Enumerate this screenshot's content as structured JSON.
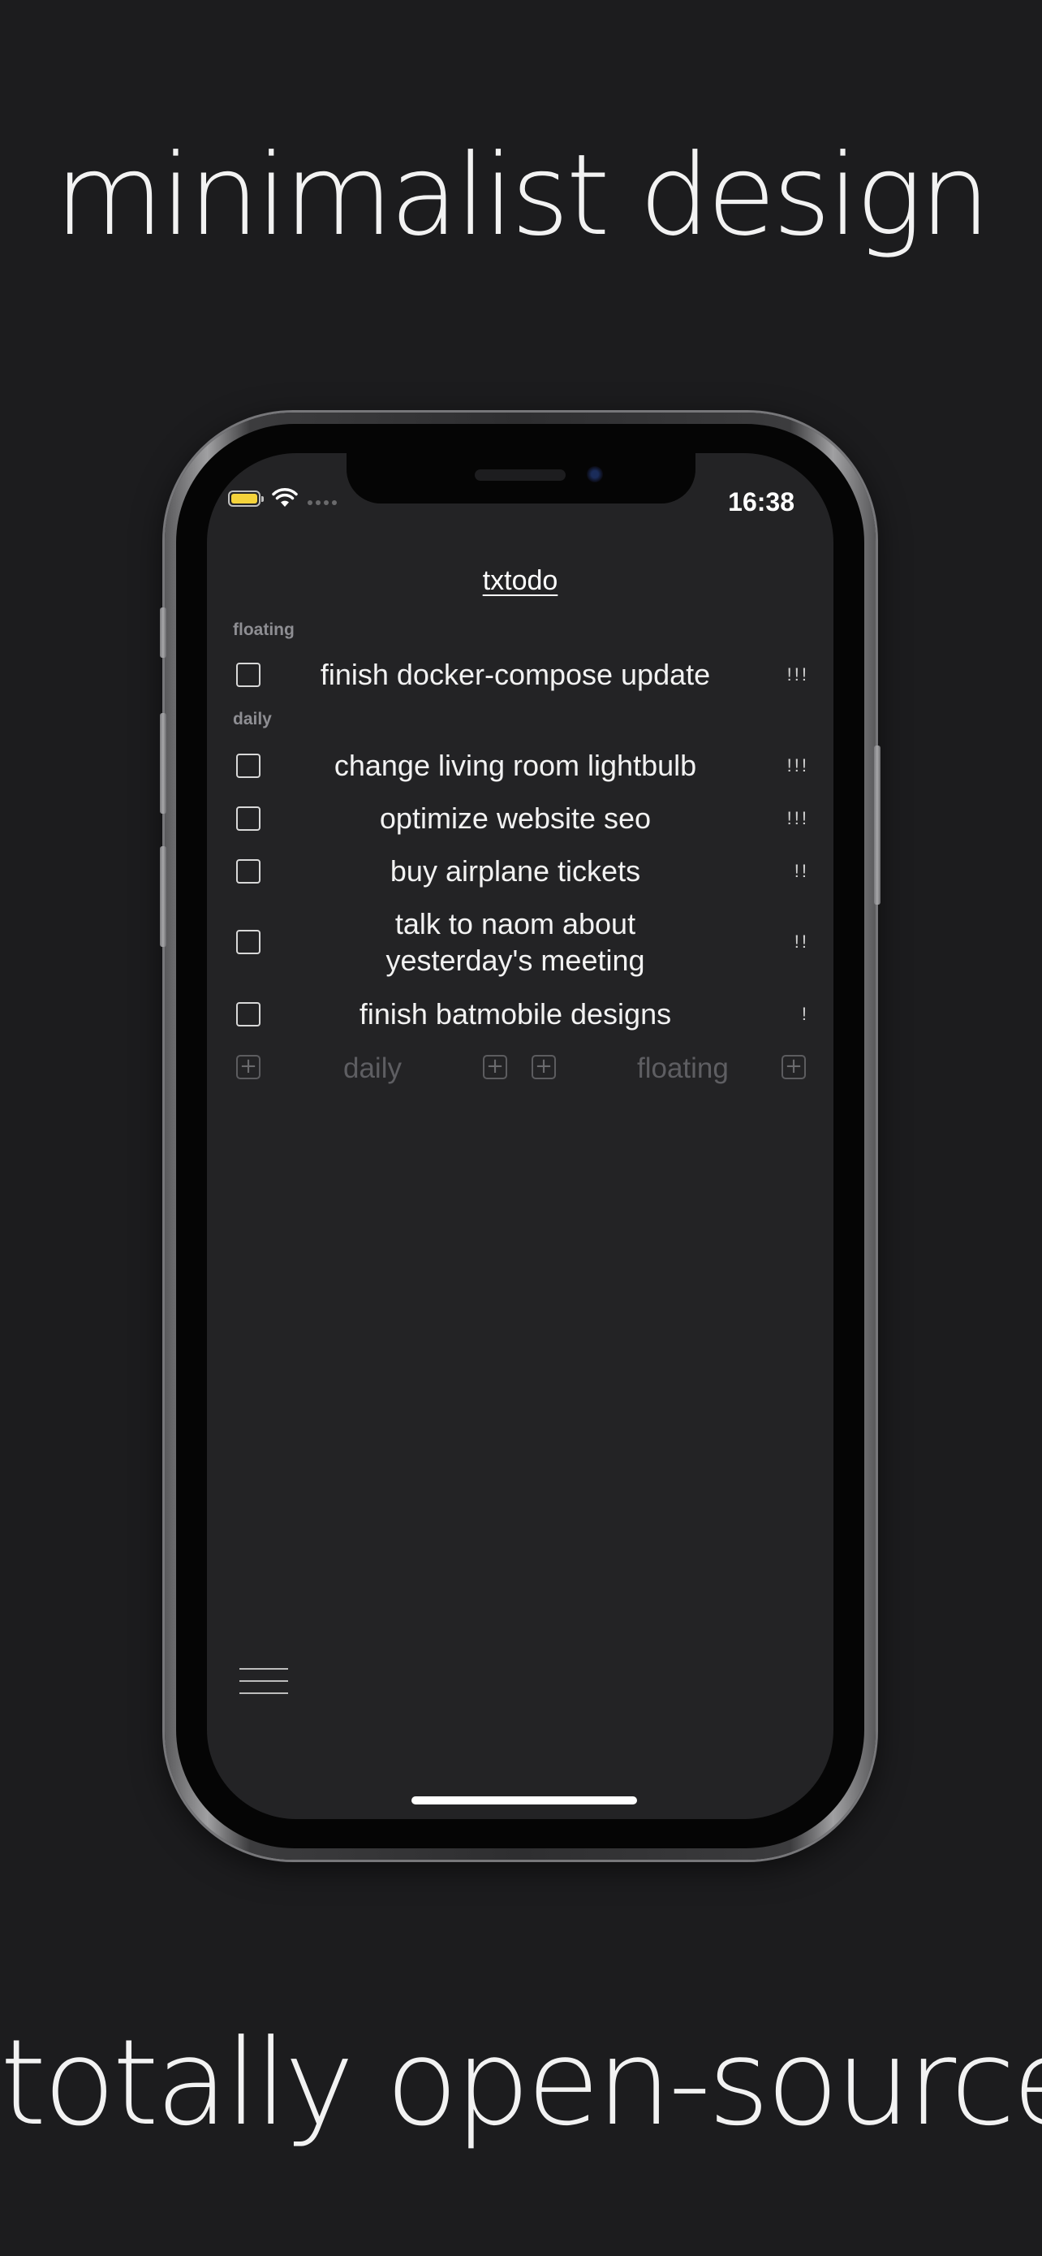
{
  "headline_top": "minimalist design",
  "headline_bottom": "totally open-source",
  "status_bar": {
    "time": "16:38",
    "battery_color": "#f5d33b",
    "wifi_icon": "wifi-icon",
    "signal_icon": "cellular-signal-icon"
  },
  "app": {
    "title": "txtodo",
    "sections": {
      "floating": {
        "label": "floating",
        "tasks": [
          {
            "text": "finish docker-compose update",
            "priority": "!!!"
          }
        ]
      },
      "daily": {
        "label": "daily",
        "tasks": [
          {
            "text": "change living room lightbulb",
            "priority": "!!!"
          },
          {
            "text": "optimize website seo",
            "priority": "!!!"
          },
          {
            "text": "buy airplane tickets",
            "priority": "!!"
          },
          {
            "text": "talk to naom about yesterday's meeting",
            "priority": "!!"
          },
          {
            "text": "finish batmobile designs",
            "priority": "!"
          }
        ]
      }
    },
    "add_row": {
      "daily_label": "daily",
      "floating_label": "floating",
      "plus_symbol": "+"
    },
    "menu_icon": "hamburger-menu-icon"
  }
}
